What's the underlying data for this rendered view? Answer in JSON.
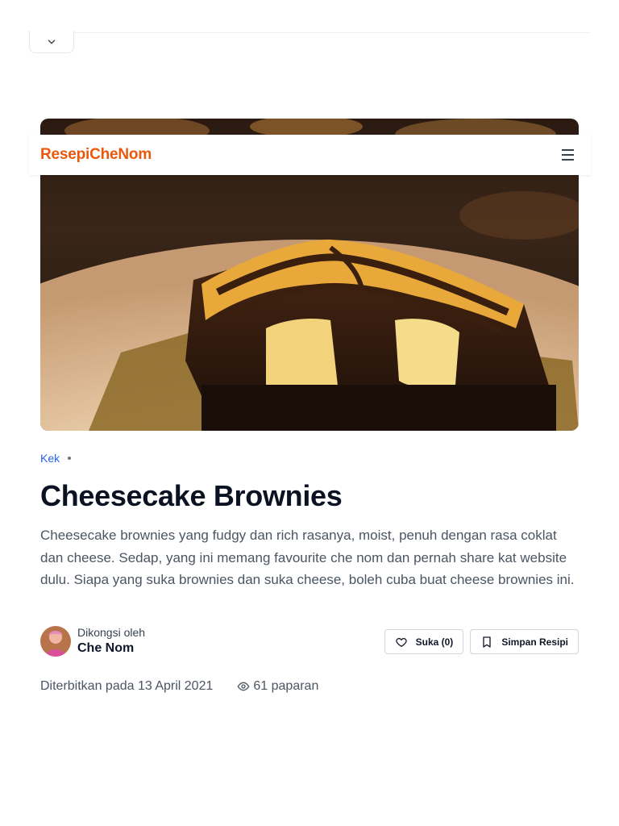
{
  "site": {
    "brand": "ResepiCheNom"
  },
  "icons": {
    "collapse": "chevron-down-icon",
    "menu": "hamburger-menu-icon",
    "like": "heart-icon",
    "save": "bookmark-icon",
    "views": "eye-icon"
  },
  "colors": {
    "brand": "#ea580c",
    "category": "#2563eb",
    "title": "#0b1222",
    "body": "#4b5563"
  },
  "recipe": {
    "category": "Kek",
    "title": "Cheesecake Brownies",
    "description": "Cheesecake brownies yang fudgy dan rich rasanya, moist, penuh dengan rasa coklat dan cheese. Sedap, yang ini memang favourite che nom dan pernah share kat website dulu. Siapa yang suka brownies dan suka cheese, boleh cuba buat cheese brownies ini.",
    "author_label": "Dikongsi oleh",
    "author_name": "Che Nom",
    "like_label": "Suka (0)",
    "save_label": "Simpan Resipi",
    "published": "Diterbitkan pada 13 April 2021",
    "views": "61 paparan"
  }
}
